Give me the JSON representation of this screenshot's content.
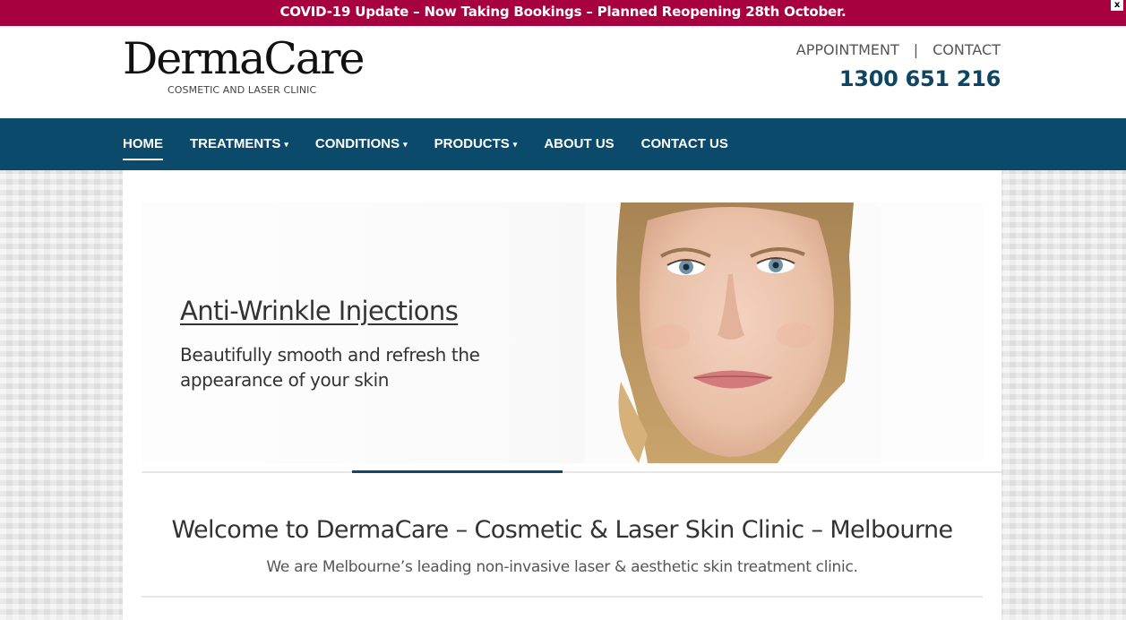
{
  "announcement": {
    "text": "COVID-19 Update – Now Taking Bookings – Planned Reopening 28th October.",
    "close_label": "x"
  },
  "brand": {
    "name": "DermaCare",
    "tagline": "COSMETIC AND LASER CLINIC"
  },
  "header": {
    "appointment_label": "APPOINTMENT",
    "separator": "|",
    "contact_label": "CONTACT",
    "phone": "1300 651 216"
  },
  "nav": {
    "items": [
      {
        "label": "HOME",
        "dropdown": false,
        "active": true
      },
      {
        "label": "TREATMENTS",
        "dropdown": true,
        "active": false
      },
      {
        "label": "CONDITIONS",
        "dropdown": true,
        "active": false
      },
      {
        "label": "PRODUCTS",
        "dropdown": true,
        "active": false
      },
      {
        "label": "ABOUT US",
        "dropdown": false,
        "active": false
      },
      {
        "label": "CONTACT US",
        "dropdown": false,
        "active": false
      }
    ],
    "dropdown_icon": "chevron-down-icon"
  },
  "hero": {
    "title": "Anti-Wrinkle Injections",
    "subtitle": "Beautifully smooth and refresh the appearance of your skin",
    "slider": {
      "slide_count": 4,
      "active_slide": 2
    }
  },
  "welcome": {
    "title": "Welcome to DermaCare – Cosmetic & Laser Skin Clinic – Melbourne",
    "subtitle": "We are Melbourne’s leading non-invasive laser & aesthetic skin treatment clinic."
  },
  "colors": {
    "announcement_bg": "#a8013f",
    "nav_bg": "#0b4a6b",
    "phone_text": "#0c4663",
    "page_bg": "#e9e9e9"
  }
}
